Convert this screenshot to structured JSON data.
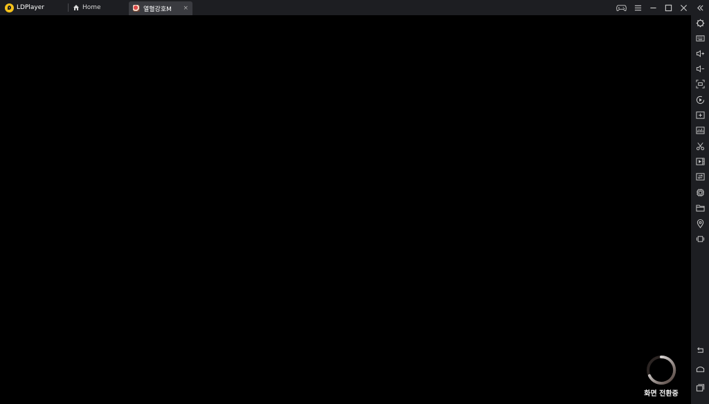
{
  "app": {
    "name": "LDPlayer"
  },
  "tabs": [
    {
      "label": "Home",
      "icon": "home-icon"
    },
    {
      "label": "열혈강호M",
      "icon": "game-icon",
      "active": true,
      "close": "×"
    }
  ],
  "window_controls": [
    "gamepad-icon",
    "menu-icon",
    "minimize-icon",
    "maximize-icon",
    "close-icon",
    "collapse-icon"
  ],
  "sidebar_tools": [
    "settings-icon",
    "keyboard-icon",
    "volume-up-icon",
    "volume-down-icon",
    "screenshot-icon",
    "record-icon",
    "install-apk-icon",
    "fps-icon",
    "scissors-icon",
    "video-icon",
    "sync-icon",
    "cpu-icon",
    "folder-icon",
    "location-icon",
    "rotate-icon"
  ],
  "sidebar_bottom": [
    "back-icon",
    "home-nav-icon",
    "recent-apps-icon"
  ],
  "loading": {
    "label": "화면 전환중"
  },
  "colors": {
    "titlebar": "#1d1e22",
    "active_tab": "#3a3b40",
    "brand": "#f6c21a"
  }
}
